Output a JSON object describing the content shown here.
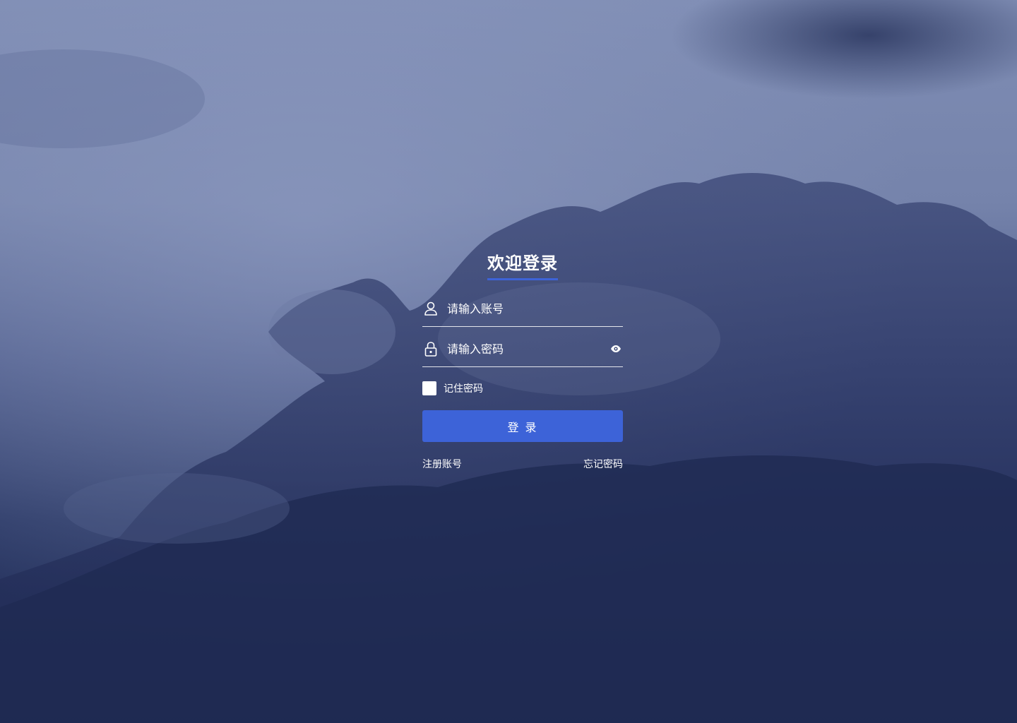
{
  "login": {
    "title": "欢迎登录",
    "account_placeholder": "请输入账号",
    "password_placeholder": "请输入密码",
    "remember_label": "记住密码",
    "remember_checked": false,
    "login_button": "登 录",
    "register_link": "注册账号",
    "forgot_link": "忘记密码"
  },
  "icons": {
    "account": "user-icon",
    "password": "lock-icon",
    "toggle": "eye-icon"
  },
  "colors": {
    "accent": "#3d63d8",
    "text": "#ffffff"
  }
}
